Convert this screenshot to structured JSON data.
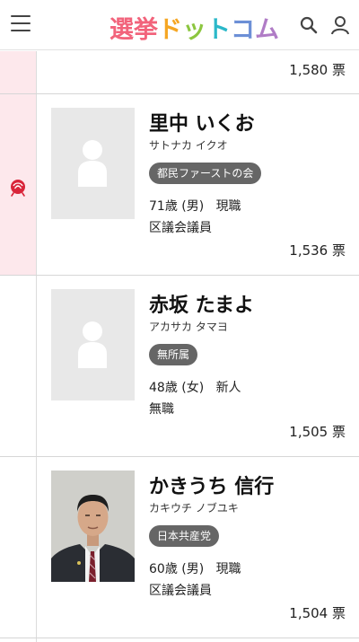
{
  "header": {
    "logo": [
      {
        "ch": "選",
        "color": "#f2637b"
      },
      {
        "ch": "挙",
        "color": "#f2637b"
      },
      {
        "ch": "ド",
        "color": "#f5a623"
      },
      {
        "ch": "ッ",
        "color": "#8cc63f"
      },
      {
        "ch": "ト",
        "color": "#2bb8c9"
      },
      {
        "ch": "コ",
        "color": "#6c8fd6"
      },
      {
        "ch": "ム",
        "color": "#b07cc6"
      }
    ],
    "icons": [
      "menu-icon",
      "search-icon",
      "user-icon"
    ]
  },
  "rows": [
    {
      "votes": "1,580 票"
    },
    {
      "winner": true,
      "name": "里中 いくお",
      "kana": "サトナカ イクオ",
      "party": "都民ファーストの会",
      "age_gender": "71歳 (男)",
      "status": "現職",
      "occupation": "区議会議員",
      "votes": "1,536 票",
      "photo": "placeholder"
    },
    {
      "winner": false,
      "name": "赤坂 たまよ",
      "kana": "アカサカ タマヨ",
      "party": "無所属",
      "age_gender": "48歳 (女)",
      "status": "新人",
      "occupation": "無職",
      "votes": "1,505 票",
      "photo": "placeholder"
    },
    {
      "winner": false,
      "name": "かきうち 信行",
      "kana": "カキウチ ノブユキ",
      "party": "日本共産党",
      "age_gender": "60歳 (男)",
      "status": "現職",
      "occupation": "区議会議員",
      "votes": "1,504 票",
      "photo": "portrait"
    }
  ],
  "colors": {
    "winner_bg": "#fde8ec",
    "rose": "#d9253a",
    "badge": "#666666"
  }
}
